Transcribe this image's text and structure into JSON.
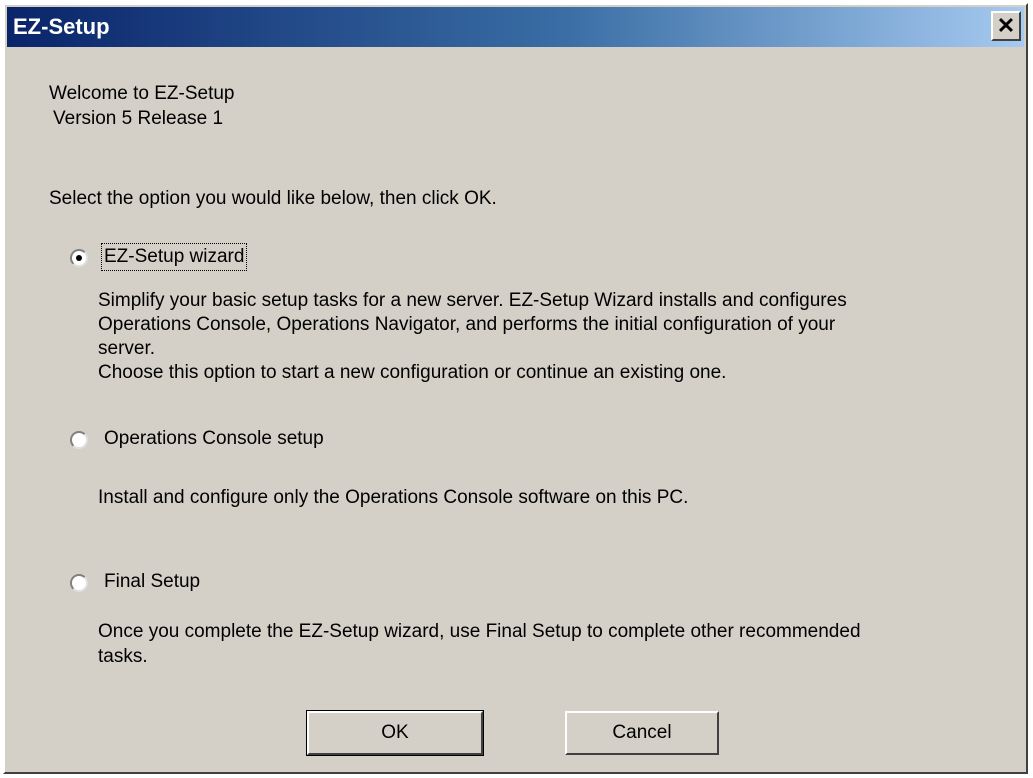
{
  "window": {
    "title": "EZ-Setup",
    "close_glyph": "✕"
  },
  "intro": {
    "welcome": "Welcome to EZ-Setup",
    "version": "Version 5 Release 1",
    "instruction": "Select the option you would like below, then click OK."
  },
  "options": [
    {
      "label": "EZ-Setup wizard",
      "selected": true,
      "description": [
        "Simplify your basic setup tasks for a new server. EZ-Setup Wizard installs and configures",
        "Operations Console, Operations Navigator, and performs the initial configuration of your",
        "server.",
        "Choose this option to start a new configuration or continue an existing one."
      ]
    },
    {
      "label": "Operations Console setup",
      "selected": false,
      "description": [
        "Install and configure only the Operations Console software on this PC."
      ]
    },
    {
      "label": "Final Setup",
      "selected": false,
      "description": [
        "Once you complete the EZ-Setup wizard, use Final Setup to complete other recommended",
        "tasks."
      ]
    }
  ],
  "buttons": {
    "ok": "OK",
    "cancel": "Cancel"
  }
}
